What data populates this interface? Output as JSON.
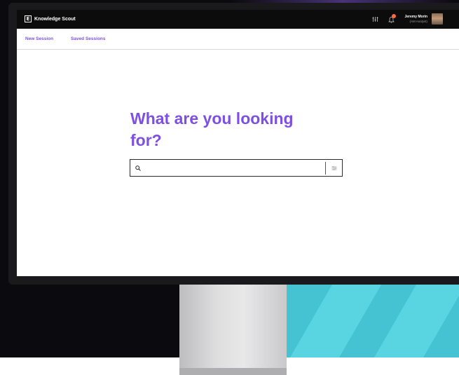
{
  "app": {
    "brand_name": "Knowledge Scout",
    "logo_glyph": "E"
  },
  "header": {
    "user_name": "Jeremy Morin",
    "user_role": "(AM Analyst)",
    "notification_count": 1,
    "icons": [
      "filter-icon",
      "bell-icon",
      "avatar"
    ]
  },
  "nav": {
    "tabs": [
      {
        "label": "New Session"
      },
      {
        "label": "Saved Sessions"
      }
    ]
  },
  "hero": {
    "title": "What are you looking for?"
  },
  "search": {
    "value": "",
    "placeholder": "",
    "icons": [
      "search-icon",
      "settings-icon"
    ]
  },
  "colors": {
    "accent": "#7e4fe3",
    "topbar": "#0c0c0c",
    "badge": "#ff6a3d",
    "teal": "#45c3d3"
  }
}
